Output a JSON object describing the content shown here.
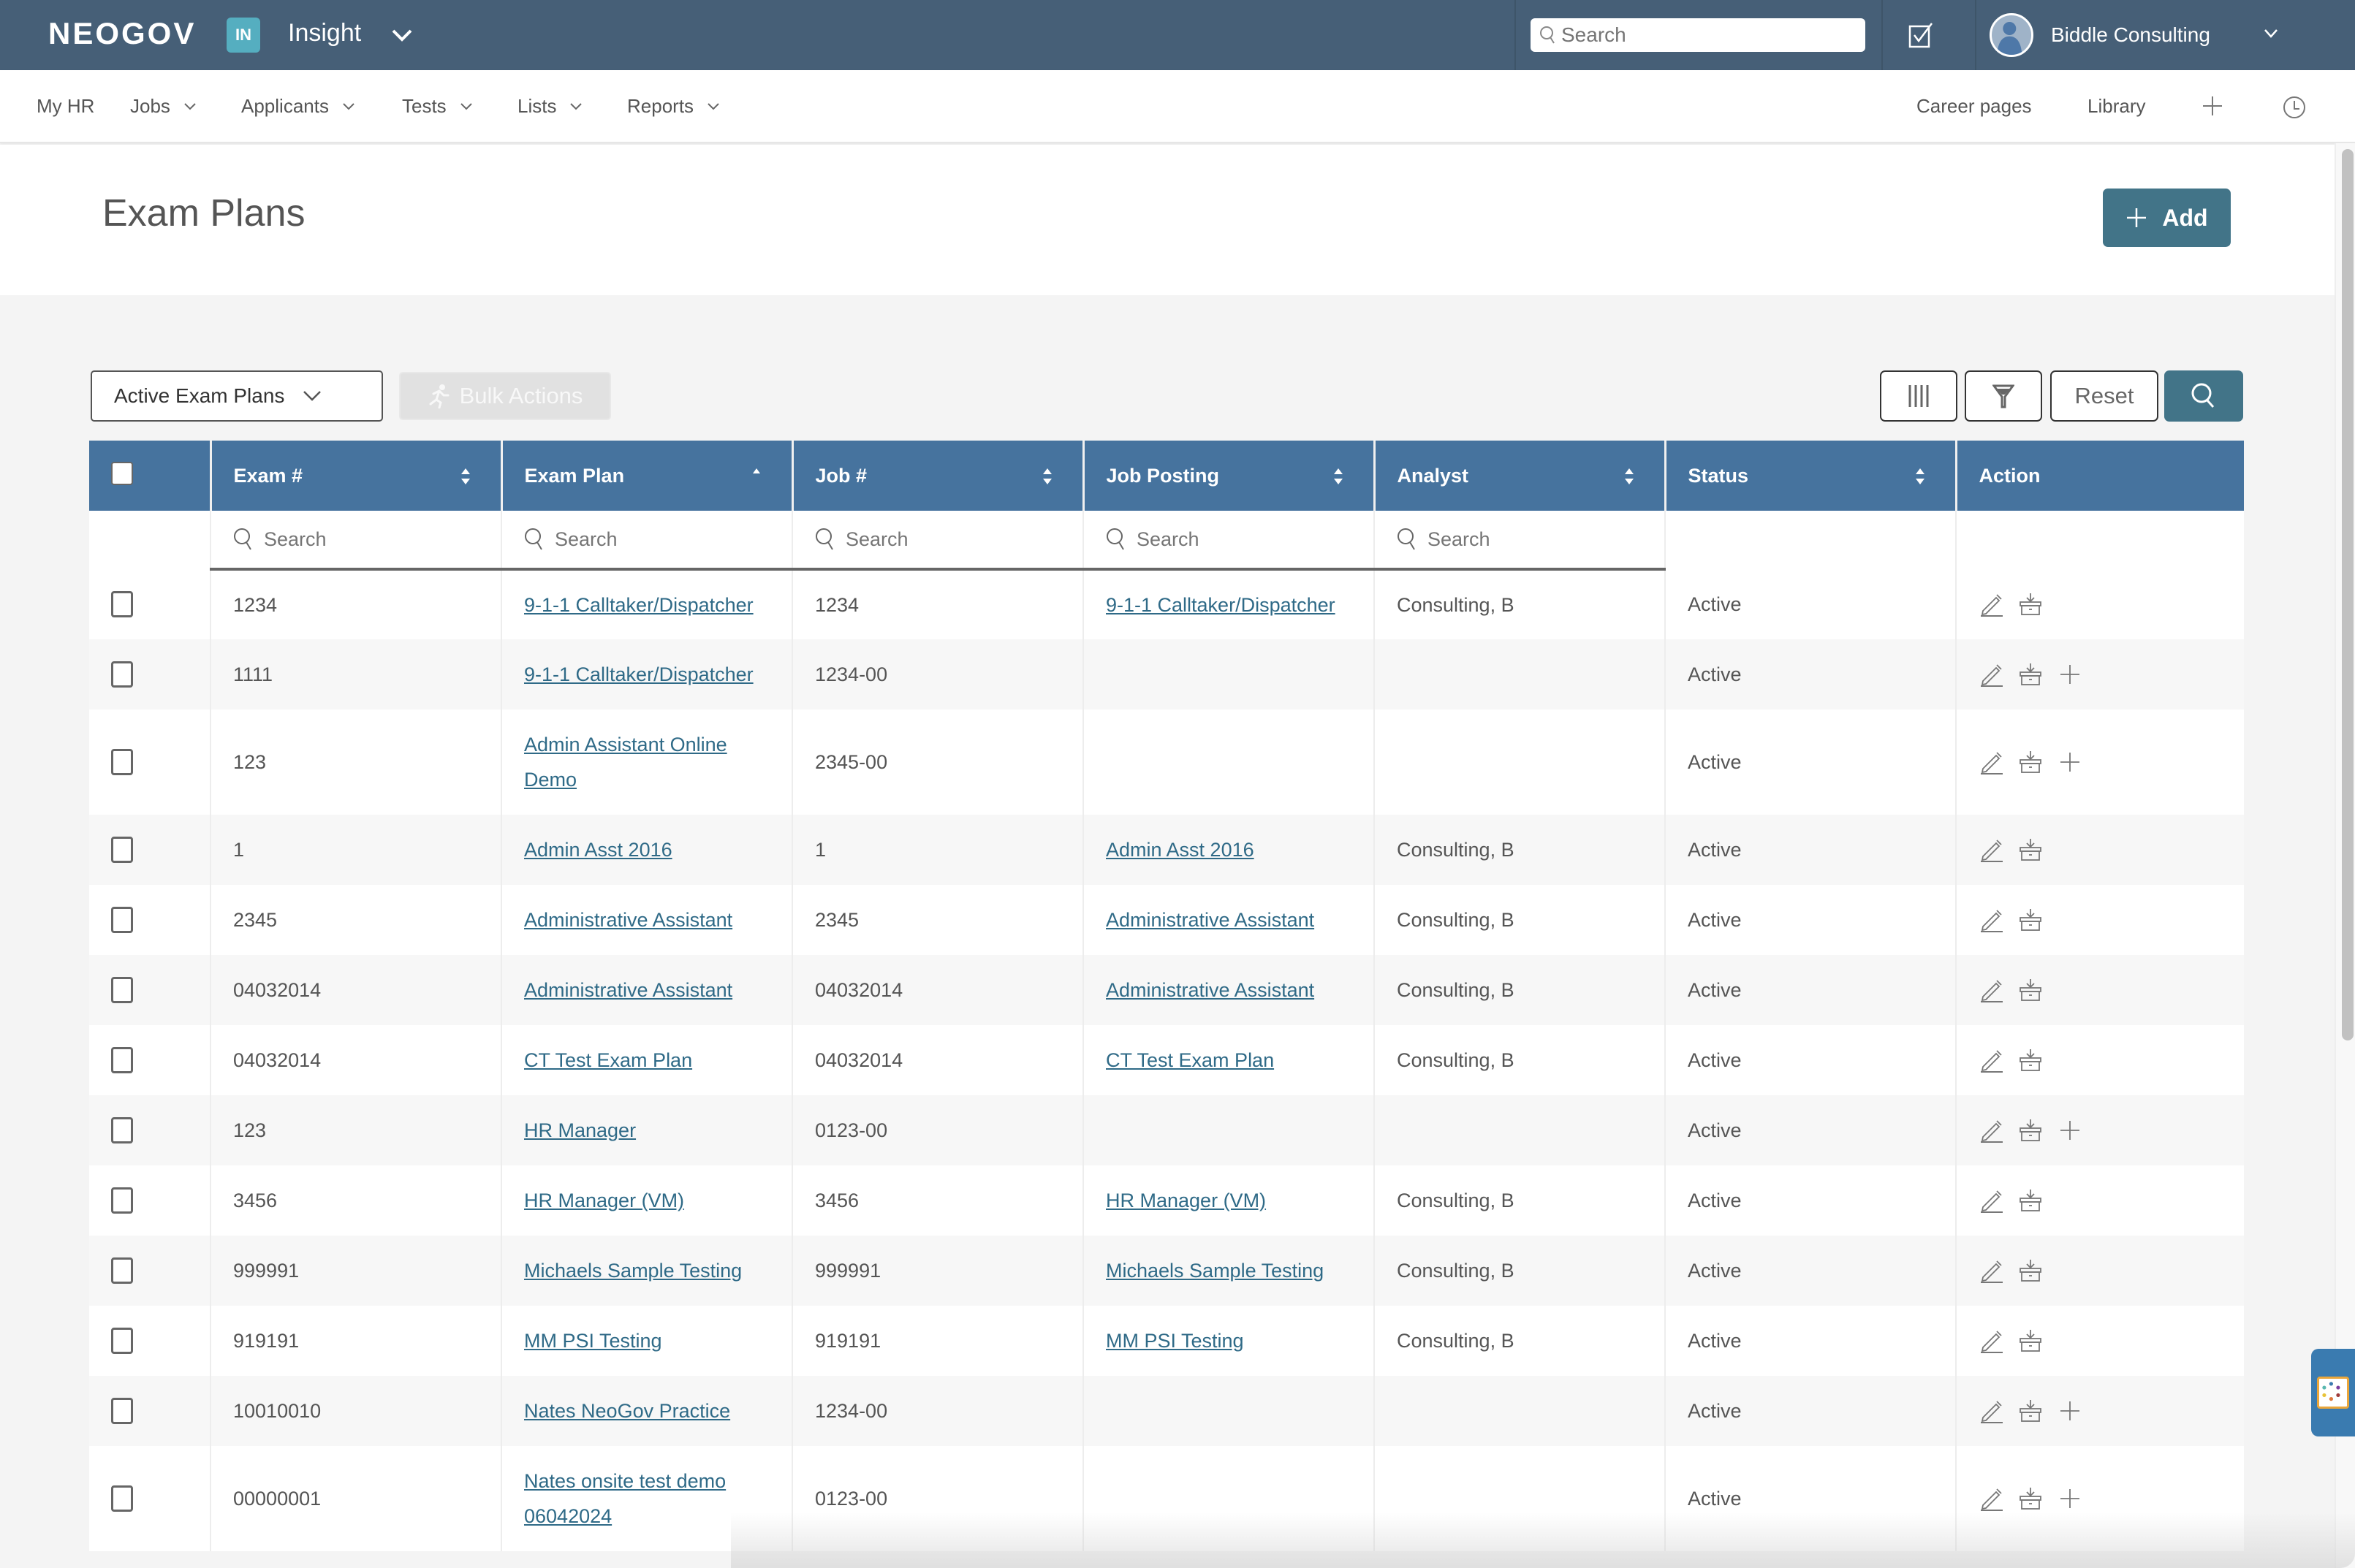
{
  "topbar": {
    "brand": "NEOGOV",
    "app_badge": "IN",
    "app_name": "Insight",
    "search_placeholder": "Search",
    "user_name": "Biddle Consulting"
  },
  "nav": {
    "left": [
      {
        "label": "My HR",
        "has_menu": false
      },
      {
        "label": "Jobs",
        "has_menu": true
      },
      {
        "label": "Applicants",
        "has_menu": true
      },
      {
        "label": "Tests",
        "has_menu": true
      },
      {
        "label": "Lists",
        "has_menu": true
      },
      {
        "label": "Reports",
        "has_menu": true
      }
    ],
    "right": [
      {
        "label": "Career pages"
      },
      {
        "label": "Library"
      }
    ]
  },
  "page": {
    "title": "Exam Plans",
    "add_label": "Add"
  },
  "toolbar": {
    "filter_selected": "Active Exam Plans",
    "bulk_actions_label": "Bulk Actions",
    "reset_label": "Reset"
  },
  "colors": {
    "topbar": "#465f77",
    "accent": "#427488",
    "table_header": "#46739e",
    "link": "#2f6a87",
    "badge": "#55aec0"
  },
  "table": {
    "columns": [
      {
        "label": "Exam #",
        "sort": "both",
        "searchable": true
      },
      {
        "label": "Exam Plan",
        "sort": "asc",
        "searchable": true
      },
      {
        "label": "Job #",
        "sort": "both",
        "searchable": true
      },
      {
        "label": "Job Posting",
        "sort": "both",
        "searchable": true
      },
      {
        "label": "Analyst",
        "sort": "both",
        "searchable": true
      },
      {
        "label": "Status",
        "sort": "both",
        "searchable": false
      },
      {
        "label": "Action",
        "sort": "none",
        "searchable": false
      }
    ],
    "search_placeholder": "Search",
    "rows": [
      {
        "exam_no": "1234",
        "exam_plan": "9-1-1 Calltaker/Dispatcher",
        "job_no": "1234",
        "job_posting": "9-1-1 Calltaker/Dispatcher",
        "analyst": "Consulting, B",
        "status": "Active",
        "can_add": false
      },
      {
        "exam_no": "1111",
        "exam_plan": "9-1-1 Calltaker/Dispatcher",
        "job_no": "1234-00",
        "job_posting": "",
        "analyst": "",
        "status": "Active",
        "can_add": true
      },
      {
        "exam_no": "123",
        "exam_plan": "Admin Assistant Online Demo",
        "job_no": "2345-00",
        "job_posting": "",
        "analyst": "",
        "status": "Active",
        "can_add": true
      },
      {
        "exam_no": "1",
        "exam_plan": "Admin Asst 2016",
        "job_no": "1",
        "job_posting": "Admin Asst 2016",
        "analyst": "Consulting, B",
        "status": "Active",
        "can_add": false
      },
      {
        "exam_no": "2345",
        "exam_plan": "Administrative Assistant",
        "job_no": "2345",
        "job_posting": "Administrative Assistant",
        "analyst": "Consulting, B",
        "status": "Active",
        "can_add": false
      },
      {
        "exam_no": "04032014",
        "exam_plan": "Administrative Assistant",
        "job_no": "04032014",
        "job_posting": "Administrative Assistant",
        "analyst": "Consulting, B",
        "status": "Active",
        "can_add": false
      },
      {
        "exam_no": "04032014",
        "exam_plan": "CT Test Exam Plan",
        "job_no": "04032014",
        "job_posting": "CT Test Exam Plan",
        "analyst": "Consulting, B",
        "status": "Active",
        "can_add": false
      },
      {
        "exam_no": "123",
        "exam_plan": "HR Manager",
        "job_no": "0123-00",
        "job_posting": "",
        "analyst": "",
        "status": "Active",
        "can_add": true
      },
      {
        "exam_no": "3456",
        "exam_plan": "HR Manager (VM)",
        "job_no": "3456",
        "job_posting": "HR Manager (VM)",
        "analyst": "Consulting, B",
        "status": "Active",
        "can_add": false
      },
      {
        "exam_no": "999991",
        "exam_plan": "Michaels Sample Testing",
        "job_no": "999991",
        "job_posting": "Michaels Sample Testing",
        "analyst": "Consulting, B",
        "status": "Active",
        "can_add": false
      },
      {
        "exam_no": "919191",
        "exam_plan": "MM PSI Testing",
        "job_no": "919191",
        "job_posting": "MM PSI Testing",
        "analyst": "Consulting, B",
        "status": "Active",
        "can_add": false
      },
      {
        "exam_no": "10010010",
        "exam_plan": "Nates NeoGov Practice",
        "job_no": "1234-00",
        "job_posting": "",
        "analyst": "",
        "status": "Active",
        "can_add": true
      },
      {
        "exam_no": "00000001",
        "exam_plan": "Nates onsite test demo 06042024",
        "job_no": "0123-00",
        "job_posting": "",
        "analyst": "",
        "status": "Active",
        "can_add": true
      }
    ]
  }
}
